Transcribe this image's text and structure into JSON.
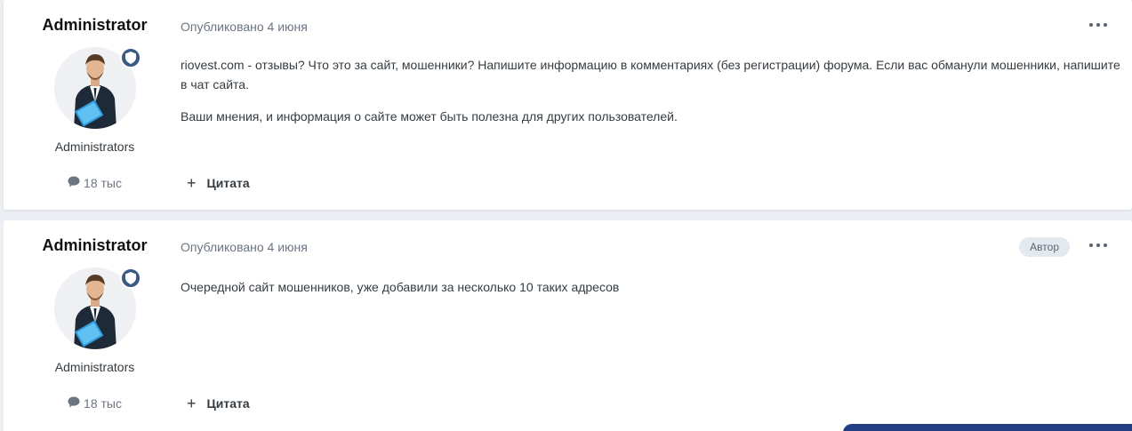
{
  "posts": [
    {
      "author": "Administrator",
      "group": "Administrators",
      "post_count": "18 тыс",
      "published": "Опубликовано 4 июня",
      "author_badge": "",
      "paragraphs": [
        "riovest.com - отзывы? Что это за сайт, мошенники? Напишите информацию в комментариях (без регистрации) форума. Если вас обманули мошенники, напишите в чат сайта.",
        "Ваши мнения, и информация о сайте может быть полезна для других пользователей."
      ],
      "quote_label": "Цитата"
    },
    {
      "author": "Administrator",
      "group": "Administrators",
      "post_count": "18 тыс",
      "published": "Опубликовано 4 июня",
      "author_badge": "Автор",
      "paragraphs": [
        "Очередной сайт мошенников, уже добавили за несколько 10 таких адресов"
      ],
      "quote_label": "Цитата"
    }
  ],
  "icons": {
    "badge": "shield-icon",
    "count": "speech-bubble-icon",
    "more": "ellipsis-icon",
    "quote": "plus-icon"
  },
  "colors": {
    "background": "#ebeef2",
    "card": "#ffffff",
    "badge": "#3b5a83",
    "accent_bar": "#233d85"
  }
}
